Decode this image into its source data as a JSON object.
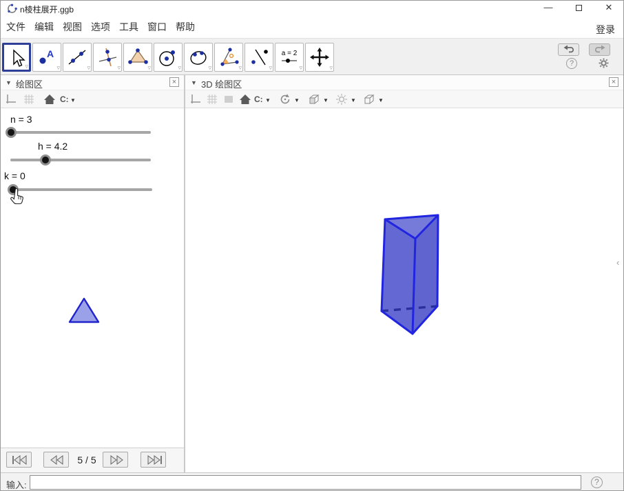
{
  "titlebar": {
    "title": "n棱柱展开.ggb"
  },
  "menubar": {
    "items": [
      "文件",
      "编辑",
      "视图",
      "选项",
      "工具",
      "窗口",
      "帮助"
    ],
    "login_label": "登录"
  },
  "toolbar": {
    "slider_tool_text": "a = 2",
    "tool_names": [
      "move",
      "point-with-label",
      "line-through-two-points",
      "perpendicular-line",
      "polygon",
      "circle-with-center",
      "ellipse",
      "angle",
      "reflect-about-line",
      "slider",
      "move-graphics-view"
    ],
    "selected_tool": "move"
  },
  "graphics_panel": {
    "title": "绘图区",
    "capture_label": "C:",
    "sliders": [
      {
        "name": "n",
        "label": "n = 3"
      },
      {
        "name": "h",
        "label": "h = 4.2"
      },
      {
        "name": "k",
        "label": "k = 0"
      }
    ],
    "nav_page_label": "5 / 5"
  },
  "graphics3d_panel": {
    "title": "3D 绘图区",
    "capture_label": "C:"
  },
  "input_bar": {
    "label": "输入:"
  },
  "colors": {
    "accent_selected": "#2d3f96",
    "edge_blue": "#2125e0",
    "face_top": "#6f74d8",
    "face_left": "#565bce",
    "face_right": "#5157cb",
    "hidden_edge": "#2a2f9e",
    "triangle_fill": "#828ae4",
    "triangle_stroke": "#2023cc",
    "slider_track": "#a6a6a6",
    "slider_handle": "#141414",
    "icon_dot_blue": "#1b2fa0"
  }
}
